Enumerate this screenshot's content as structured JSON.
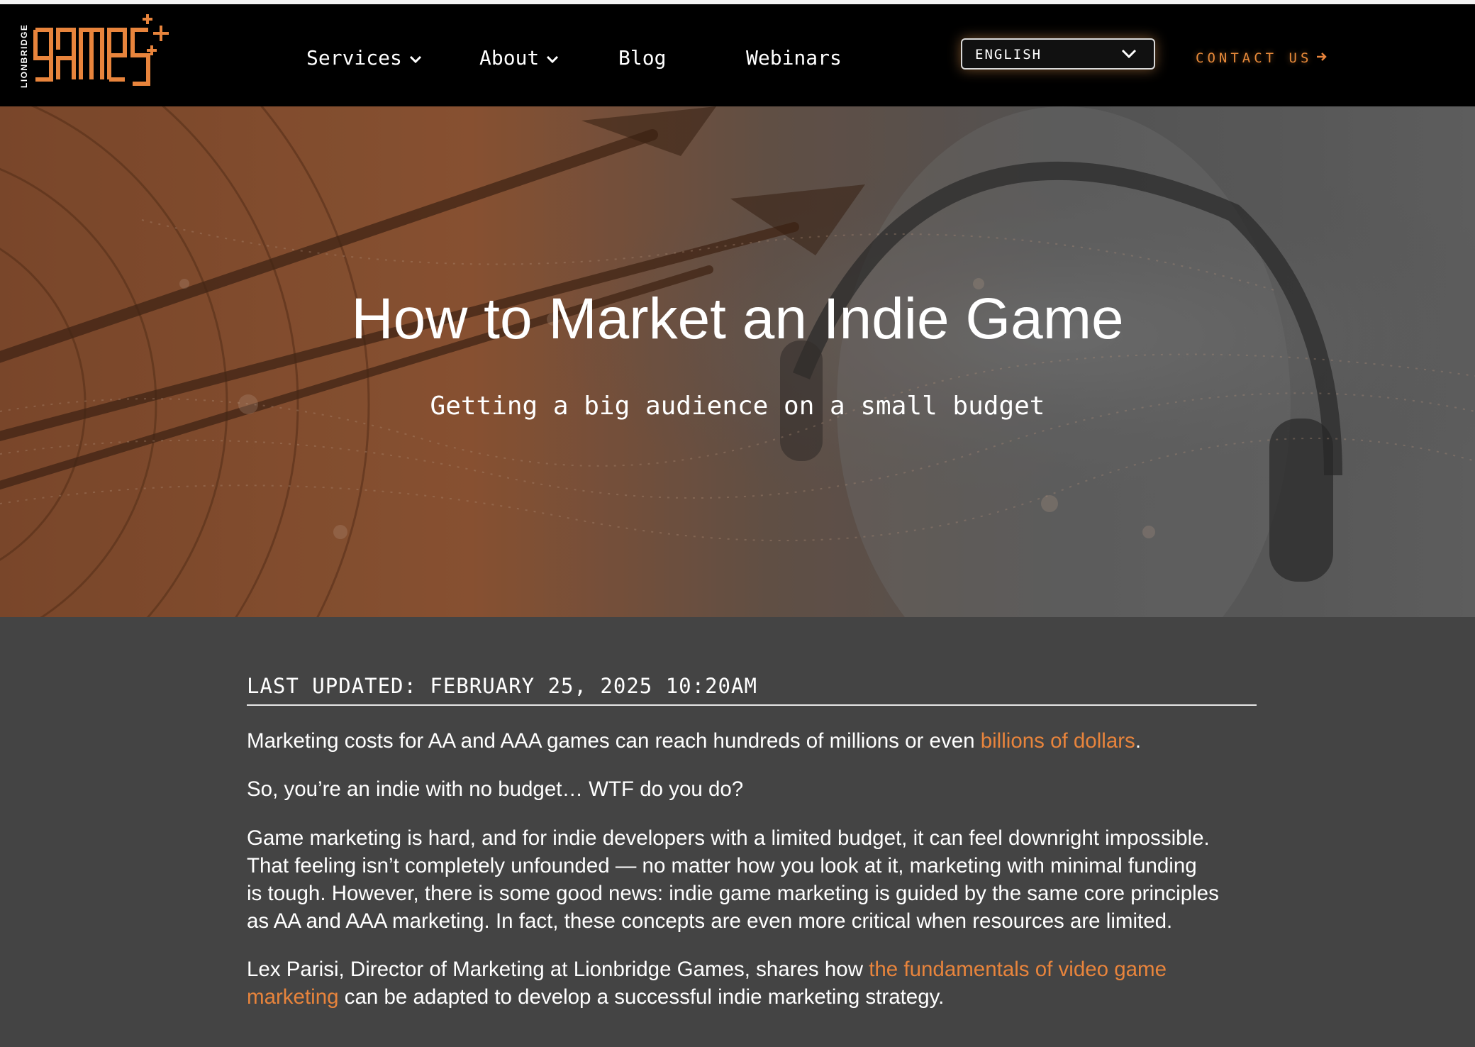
{
  "header": {
    "logo": {
      "brand_small": "LIONBRIDGE",
      "brand_large": "games"
    },
    "nav": [
      {
        "label": "Services",
        "has_dropdown": true
      },
      {
        "label": "About",
        "has_dropdown": true
      },
      {
        "label": "Blog",
        "has_dropdown": false
      },
      {
        "label": "Webinars",
        "has_dropdown": false
      }
    ],
    "language_select": {
      "value": "ENGLISH"
    },
    "contact": {
      "label": "CONTACT US",
      "icon": "arrow-right-icon"
    }
  },
  "hero": {
    "title": "How to Market an Indie Game",
    "subtitle": "Getting a big audience on a small budget"
  },
  "article": {
    "updated": "LAST UPDATED: FEBRUARY 25, 2025 10:20AM",
    "p1_a": "Marketing costs for AA and AAA games can reach hundreds of millions or even ",
    "p1_link": "billions of dollars",
    "p1_b": ".",
    "p2": "So, you’re an indie with no budget… WTF do you do?",
    "p3_l1": "Game marketing is hard, and for indie developers with a limited budget, it can feel downright impossible.",
    "p3_l2": "That feeling isn’t completely unfounded — no matter how you look at it, marketing with minimal funding",
    "p3_l3": "is tough. However, there is some good news: indie game marketing is guided by the same core principles",
    "p3_l4": "as AA and AAA marketing. In fact, these concepts are even more critical when resources are limited.",
    "p4_a": "Lex Parisi, Director of Marketing at Lionbridge Games, shares how ",
    "p4_link_l1": "the fundamentals of video game",
    "p4_link_l2": "marketing",
    "p4_b": " can be adapted to develop a successful indie marketing strategy."
  },
  "colors": {
    "accent": "#e8843c",
    "nav_bg": "#000000",
    "content_bg": "#444444"
  }
}
